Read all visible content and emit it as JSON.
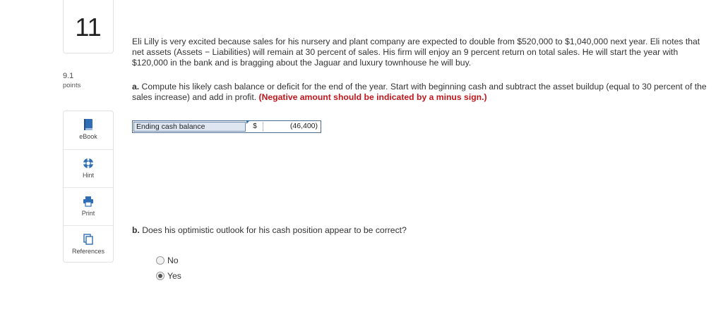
{
  "question": {
    "number": "11",
    "points_value": "9.1",
    "points_label": "points"
  },
  "tools": [
    {
      "label": "eBook",
      "icon": "book-icon"
    },
    {
      "label": "Hint",
      "icon": "lifebuoy-icon"
    },
    {
      "label": "Print",
      "icon": "printer-icon"
    },
    {
      "label": "References",
      "icon": "copy-icon"
    }
  ],
  "problem": {
    "paragraph": "Eli Lilly is very excited because sales for his nursery and plant company are expected to double from $520,000 to $1,040,000 next year. Eli notes that net assets (Assets − Liabilities) will remain at 30 percent of sales. His firm will enjoy an 9 percent return on total sales. He will start the year with $120,000 in the bank and is bragging about the Jaguar and luxury townhouse he will buy.",
    "part_a_prefix": "a.",
    "part_a_text": " Compute his likely cash balance or deficit for the end of the year. Start with beginning cash and subtract the asset buildup (equal to 30 percent of the sales increase) and add in profit. ",
    "part_a_note": "(Negative amount should be indicated by a minus sign.)",
    "part_b_prefix": "b.",
    "part_b_text": " Does his optimistic outlook for his cash position appear to be correct?"
  },
  "answer": {
    "label": "Ending cash balance",
    "currency": "$",
    "value": "(46,400)"
  },
  "options": [
    {
      "label": "No",
      "checked": false
    },
    {
      "label": "Yes",
      "checked": true
    }
  ],
  "colors": {
    "note_red": "#c0161b",
    "tool_blue": "#2f6db5",
    "label_cell_bg": "#dde6f1"
  }
}
